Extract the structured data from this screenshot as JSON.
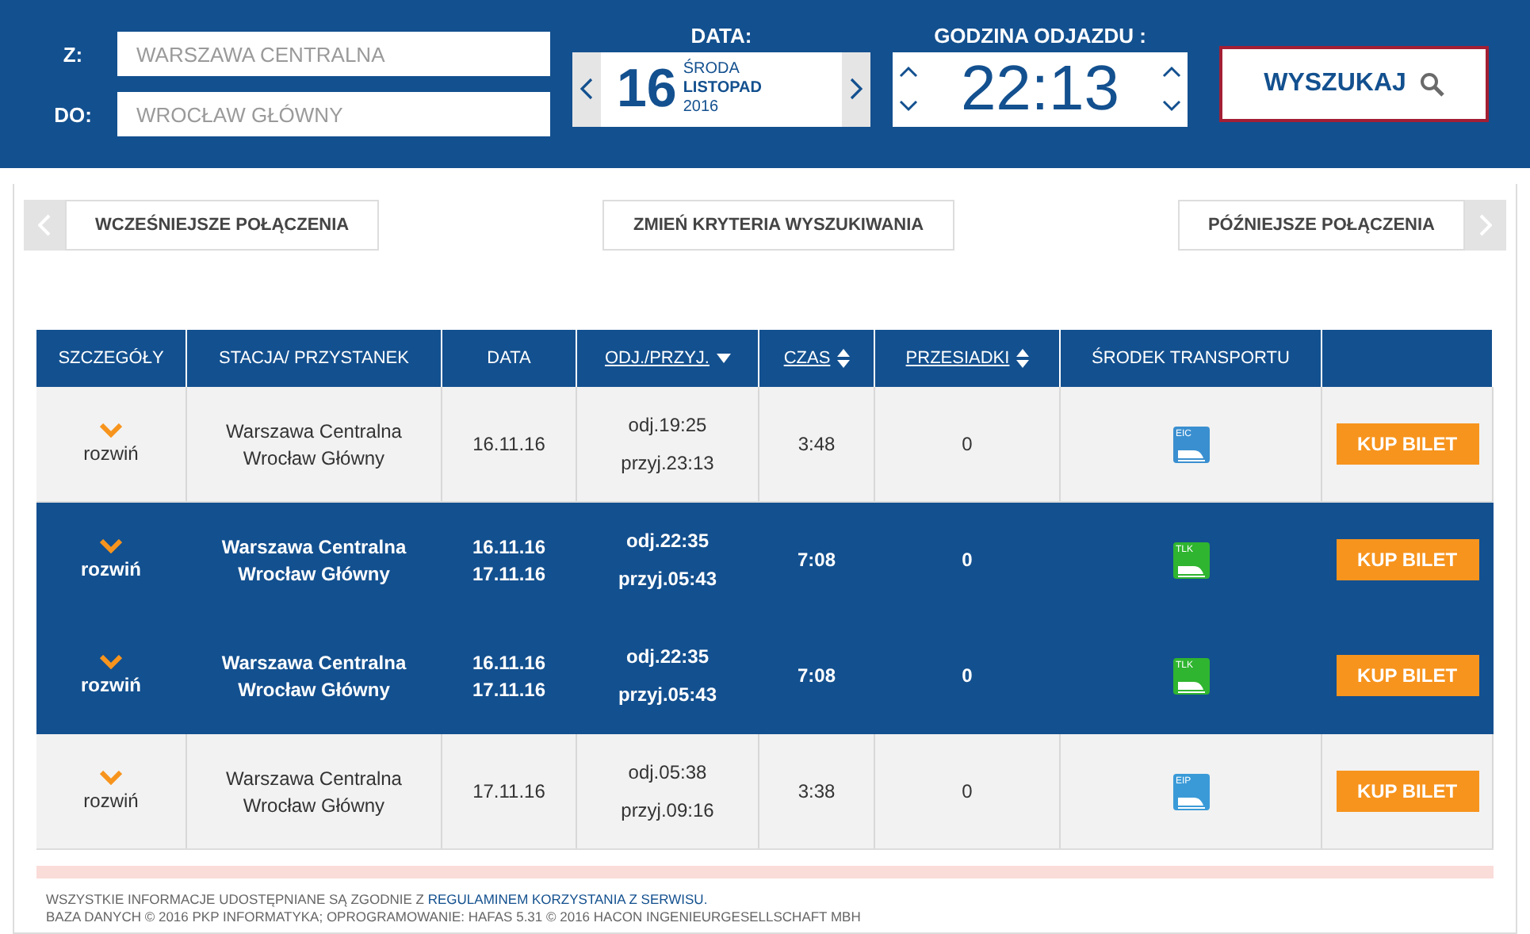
{
  "search": {
    "from_label": "Z:",
    "from_placeholder": "WARSZAWA CENTRALNA",
    "to_label": "DO:",
    "to_placeholder": "WROCŁAW GŁÓWNY",
    "date_label": "DATA:",
    "day": "16",
    "weekday": "ŚRODA",
    "month": "LISTOPAD",
    "year": "2016",
    "time_label": "GODZINA ODJAZDU :",
    "time": "22:13",
    "search_button": "WYSZUKAJ"
  },
  "nav": {
    "earlier": "WCZEŚNIEJSZE POŁĄCZENIA",
    "change": "ZMIEŃ KRYTERIA WYSZUKIWANIA",
    "later": "PÓŹNIEJSZE POŁĄCZENIA"
  },
  "table": {
    "columns": [
      {
        "label": "SZCZEGÓŁY",
        "sortable": false
      },
      {
        "label": "STACJA/ PRZYSTANEK",
        "sortable": false
      },
      {
        "label": "DATA",
        "sortable": false
      },
      {
        "label": "ODJ./PRZYJ.",
        "sortable": true,
        "sorted_descending": true
      },
      {
        "label": "CZAS",
        "sortable": true,
        "sorted_descending": false
      },
      {
        "label": "PRZESIADKI",
        "sortable": true,
        "sorted_descending": false
      },
      {
        "label": "ŚRODEK TRANSPORTU",
        "sortable": false
      }
    ],
    "rows": [
      {
        "selected": false,
        "expand": "rozwiń",
        "stations": [
          "Warszawa Centralna",
          "Wrocław Główny"
        ],
        "dates": [
          "16.11.16"
        ],
        "dep": "odj.19:25",
        "arr": "przyj.23:13",
        "duration": "3:48",
        "changes": "0",
        "carrier": "EIC",
        "color": "#3a8fd0",
        "buy": "KUP BILET"
      },
      {
        "selected": true,
        "expand": "rozwiń",
        "stations": [
          "Warszawa Centralna",
          "Wrocław Główny"
        ],
        "dates": [
          "16.11.16",
          "17.11.16"
        ],
        "dep": "odj.22:35",
        "arr": "przyj.05:43",
        "duration": "7:08",
        "changes": "0",
        "carrier": "TLK",
        "color": "#2fb52f",
        "buy": "KUP BILET"
      },
      {
        "selected": true,
        "expand": "rozwiń",
        "stations": [
          "Warszawa Centralna",
          "Wrocław Główny"
        ],
        "dates": [
          "16.11.16",
          "17.11.16"
        ],
        "dep": "odj.22:35",
        "arr": "przyj.05:43",
        "duration": "7:08",
        "changes": "0",
        "carrier": "TLK",
        "color": "#2fb52f",
        "buy": "KUP BILET"
      },
      {
        "selected": false,
        "expand": "rozwiń",
        "stations": [
          "Warszawa Centralna",
          "Wrocław Główny"
        ],
        "dates": [
          "17.11.16"
        ],
        "dep": "odj.05:38",
        "arr": "przyj.09:16",
        "duration": "3:38",
        "changes": "0",
        "carrier": "EIP",
        "color": "#3a9ad8",
        "buy": "KUP BILET"
      }
    ]
  },
  "footer": {
    "notice": "WSZYSTKIE INFORMACJE UDOSTĘPNIANE SĄ ZGODNIE Z",
    "link": "REGULAMINEM KORZYSTANIA Z SERWISU.",
    "credits": "BAZA DANYCH © 2016 PKP INFORMATYKA; OPROGRAMOWANIE: HAFAS 5.31 © 2016 HACON INGENIEURGESELLSCHAFT MBH"
  }
}
